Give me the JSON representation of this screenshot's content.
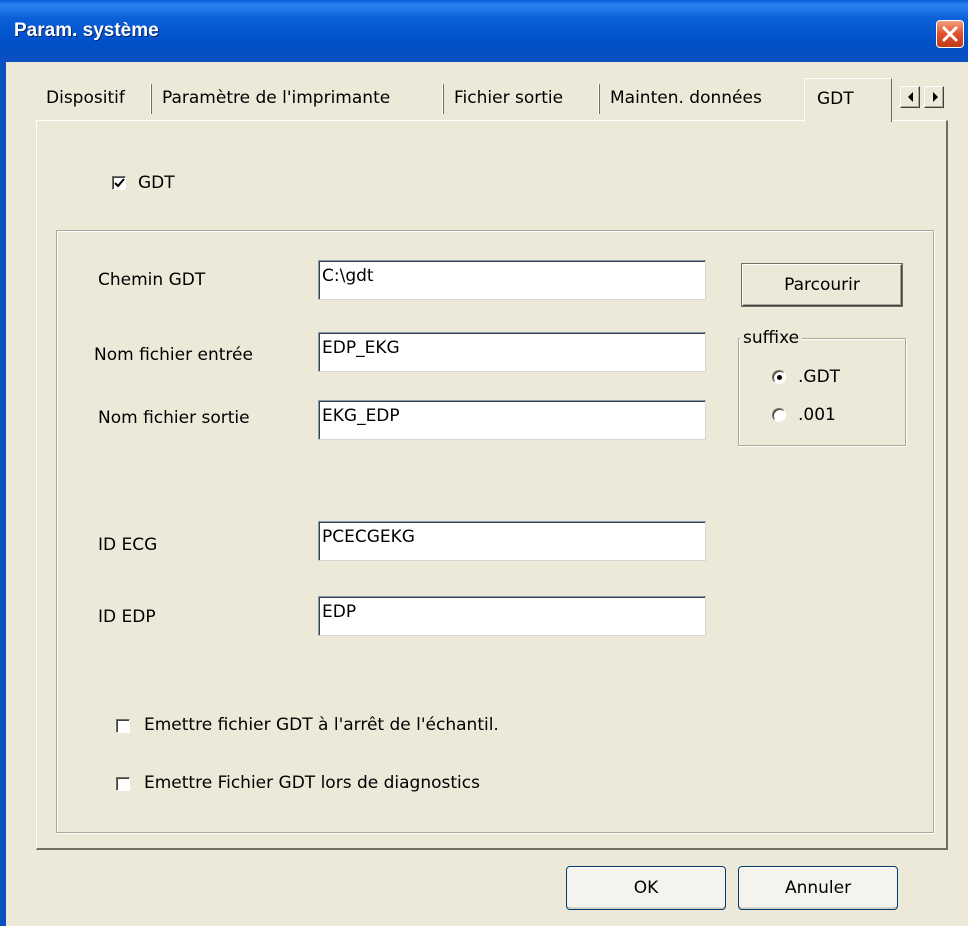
{
  "window": {
    "title": "Param. système"
  },
  "tabs": [
    {
      "label": "Dispositif"
    },
    {
      "label": "Paramètre de l'imprimante"
    },
    {
      "label": "Fichier sortie"
    },
    {
      "label": "Mainten. données"
    },
    {
      "label": "GDT",
      "active": true
    }
  ],
  "gdt_checkbox": {
    "label": "GDT",
    "checked": true
  },
  "fields": {
    "chemin_gdt": {
      "label": "Chemin GDT",
      "value": "C:\\gdt"
    },
    "nom_fichier_entree": {
      "label": "Nom fichier entrée",
      "value": "EDP_EKG"
    },
    "nom_fichier_sortie": {
      "label": "Nom fichier sortie",
      "value": "EKG_EDP"
    },
    "id_ecg": {
      "label": "ID ECG",
      "value": "PCECGEKG"
    },
    "id_edp": {
      "label": "ID EDP",
      "value": "EDP"
    }
  },
  "browse_button": {
    "label": "Parcourir"
  },
  "suffix": {
    "legend": "suffixe",
    "options": [
      {
        "label": ".GDT",
        "selected": true
      },
      {
        "label": ".001",
        "selected": false
      }
    ]
  },
  "options": [
    {
      "label": "Emettre fichier GDT à l'arrêt de l'échantil.",
      "checked": false
    },
    {
      "label": "Emettre Fichier GDT lors de diagnostics",
      "checked": false
    }
  ],
  "footer": {
    "ok_label": "OK",
    "cancel_label": "Annuler"
  },
  "colors": {
    "titlebar": "#0A5FD8",
    "dialog_bg": "#ECE9D8",
    "close_button": "#E0502A"
  }
}
